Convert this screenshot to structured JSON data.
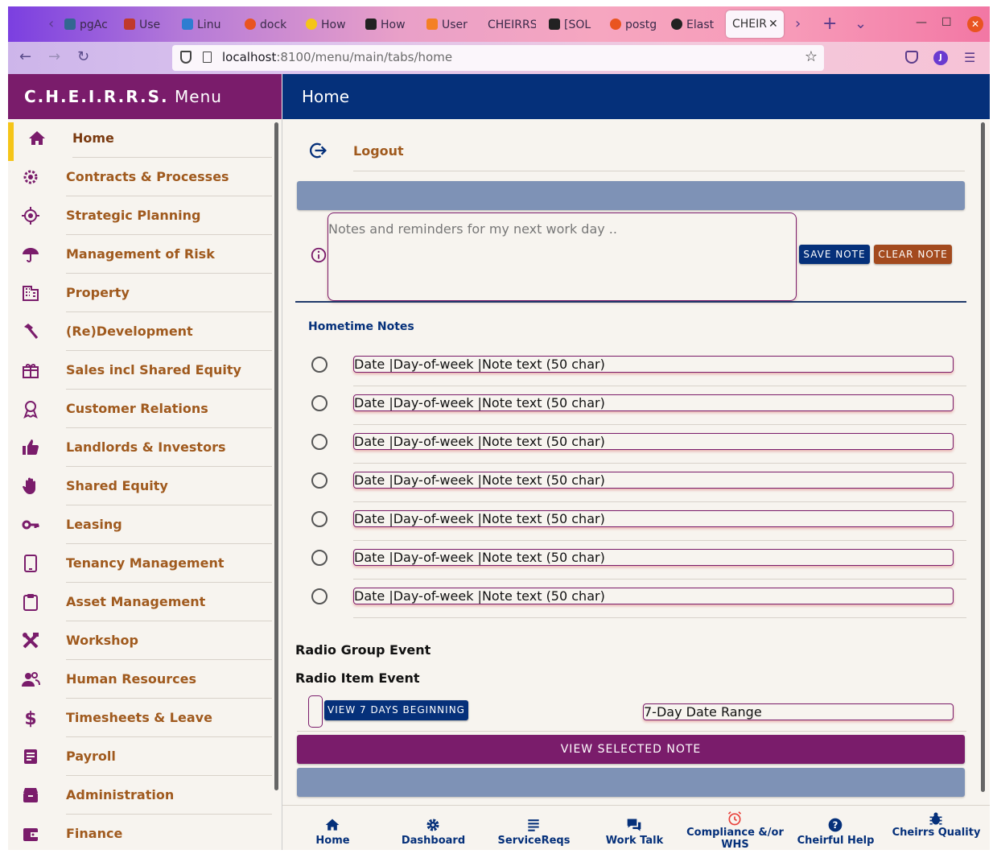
{
  "browser": {
    "tabs": [
      {
        "label": "pgAc",
        "icon_color": "#336791"
      },
      {
        "label": "Use",
        "icon_color": "#c0392b"
      },
      {
        "label": "Linu",
        "icon_color": "#2e7dd1"
      },
      {
        "label": "dock",
        "icon_color": "#e95420"
      },
      {
        "label": "How",
        "icon_color": "#f5c518"
      },
      {
        "label": "How",
        "icon_color": "#222222"
      },
      {
        "label": "User",
        "icon_color": "#f48024"
      },
      {
        "label": "CHEIRRS",
        "icon_color": ""
      },
      {
        "label": "[SOL",
        "icon_color": "#222222"
      },
      {
        "label": "postg",
        "icon_color": "#e95420"
      },
      {
        "label": "Elast",
        "icon_color": "#222222"
      }
    ],
    "active_tab": "CHEIR",
    "url_host": "localhost",
    "url_rest": ":8100/menu/main/tabs/home",
    "profile_initial": "J"
  },
  "menu": {
    "title_bold": "C.H.E.I.R.R.S.",
    "title_rest": "Menu",
    "items": [
      {
        "label": "Home",
        "icon": "home-icon"
      },
      {
        "label": "Contracts & Processes",
        "icon": "cog-icon"
      },
      {
        "label": "Strategic Planning",
        "icon": "target-icon"
      },
      {
        "label": "Management of Risk",
        "icon": "umbrella-icon"
      },
      {
        "label": "Property",
        "icon": "building-icon"
      },
      {
        "label": "(Re)Development",
        "icon": "hammer-icon"
      },
      {
        "label": "Sales incl Shared Equity",
        "icon": "gift-icon"
      },
      {
        "label": "Customer Relations",
        "icon": "ribbon-icon"
      },
      {
        "label": "Landlords & Investors",
        "icon": "thumbs-up-icon"
      },
      {
        "label": "Shared Equity",
        "icon": "hand-icon"
      },
      {
        "label": "Leasing",
        "icon": "key-icon"
      },
      {
        "label": "Tenancy Management",
        "icon": "tablet-icon"
      },
      {
        "label": "Asset Management",
        "icon": "clipboard-icon"
      },
      {
        "label": "Workshop",
        "icon": "tools-icon"
      },
      {
        "label": "Human Resources",
        "icon": "people-icon"
      },
      {
        "label": "Timesheets & Leave",
        "icon": "dollar-icon"
      },
      {
        "label": "Payroll",
        "icon": "document-icon"
      },
      {
        "label": "Administration",
        "icon": "archive-icon"
      },
      {
        "label": "Finance",
        "icon": "wallet-icon"
      }
    ]
  },
  "page": {
    "title": "Home",
    "logout_label": "Logout",
    "note_placeholder": "Notes and reminders for my next work day ..",
    "save_note": "SAVE NOTE",
    "clear_note": "CLEAR NOTE",
    "hometime_title": "Hometime Notes",
    "notes": [
      "Date |Day-of-week |Note text (50 char)",
      "Date |Day-of-week |Note text (50 char)",
      "Date |Day-of-week |Note text (50 char)",
      "Date |Day-of-week |Note text (50 char)",
      "Date |Day-of-week |Note text (50 char)",
      "Date |Day-of-week |Note text (50 char)",
      "Date |Day-of-week |Note text (50 char)"
    ],
    "radio_group_event": "Radio Group Event",
    "radio_item_event": "Radio Item Event",
    "view_7_days": "VIEW 7 DAYS BEGINNING",
    "date_range": "7-Day Date Range",
    "view_selected_note": "VIEW SELECTED NOTE"
  },
  "tabs": [
    {
      "label": "Home",
      "icon": "home-icon"
    },
    {
      "label": "Dashboard",
      "icon": "cog-icon"
    },
    {
      "label": "ServiceReqs",
      "icon": "list-icon"
    },
    {
      "label": "Work Talk",
      "icon": "chat-icon"
    },
    {
      "label": "Compliance &/or WHS",
      "icon": "alarm-icon"
    },
    {
      "label": "Cheirful Help",
      "icon": "help-icon"
    },
    {
      "label": "Cheirrs Quality",
      "icon": "bug-icon"
    }
  ],
  "colors": {
    "menu_header": "#7a1c6b",
    "main_header": "#05307a",
    "menu_text": "#a05a1e",
    "selected_bar": "#f5c518",
    "tab_text": "#05307a",
    "alarm": "#e8403a"
  }
}
